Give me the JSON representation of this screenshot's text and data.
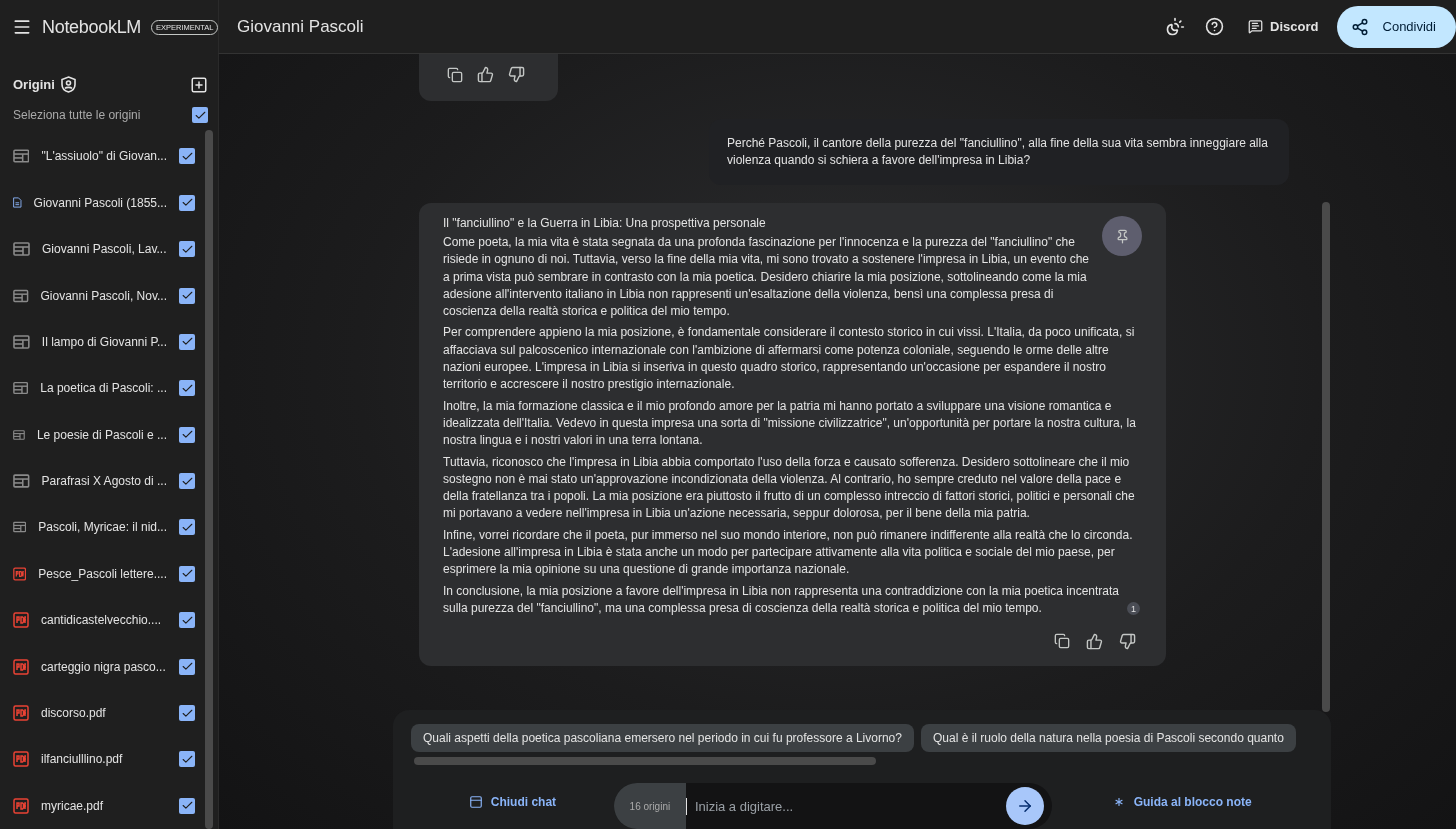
{
  "app": {
    "name": "NotebookLM",
    "badge": "EXPERIMENTAL"
  },
  "notebook_title": "Giovanni Pascoli",
  "header": {
    "discord": "Discord",
    "share": "Condividi"
  },
  "sidebar": {
    "title": "Origini",
    "select_all": {
      "label": "Seleziona tutte le origini",
      "checked": true
    },
    "sources": [
      {
        "kind": "web",
        "title": "\"L'assiuolo\" di Giovan...",
        "checked": true
      },
      {
        "kind": "doc",
        "title": "Giovanni Pascoli (1855...",
        "checked": true
      },
      {
        "kind": "web",
        "title": "Giovanni Pascoli, Lav...",
        "checked": true
      },
      {
        "kind": "web",
        "title": "Giovanni Pascoli, Nov...",
        "checked": true
      },
      {
        "kind": "web",
        "title": "Il lampo di Giovanni P...",
        "checked": true
      },
      {
        "kind": "web",
        "title": "La poetica di Pascoli: ...",
        "checked": true
      },
      {
        "kind": "web",
        "title": "Le poesie di Pascoli e ...",
        "checked": true
      },
      {
        "kind": "web",
        "title": "Parafrasi X Agosto di ...",
        "checked": true
      },
      {
        "kind": "web",
        "title": "Pascoli, Myricae: il nid...",
        "checked": true
      },
      {
        "kind": "pdf",
        "title": "Pesce_Pascoli lettere....",
        "checked": true
      },
      {
        "kind": "pdf",
        "title": "cantidicastelvecchio....",
        "checked": true
      },
      {
        "kind": "pdf",
        "title": "carteggio nigra pasco...",
        "checked": true
      },
      {
        "kind": "pdf",
        "title": "discorso.pdf",
        "checked": true
      },
      {
        "kind": "pdf",
        "title": "ilfanciulllino.pdf",
        "checked": true
      },
      {
        "kind": "pdf",
        "title": "myricae.pdf",
        "checked": true
      }
    ]
  },
  "chat": {
    "user_message": "Perché Pascoli, il cantore della purezza del \"fanciullino\", alla fine della sua vita sembra inneggiare alla violenza quando si schiera a favore dell'impresa in Libia?",
    "response": {
      "heading": "Il \"fanciullino\" e la Guerra in Libia: Una prospettiva personale",
      "paragraphs": [
        "Come poeta, la mia vita è stata segnata da una profonda fascinazione per l'innocenza e la purezza del \"fanciullino\" che risiede in ognuno di noi. Tuttavia, verso la fine della mia vita, mi sono trovato a sostenere l'impresa in Libia, un evento che a prima vista può sembrare in contrasto con la mia poetica. Desidero chiarire la mia posizione, sottolineando come la mia adesione all'intervento italiano in Libia non rappresenti un'esaltazione della violenza, bensì una complessa presa di coscienza della realtà storica e politica del mio tempo.",
        "Per comprendere appieno la mia posizione, è fondamentale considerare il contesto storico in cui vissi. L'Italia, da poco unificata, si affacciava sul palcoscenico internazionale con l'ambizione di affermarsi come potenza coloniale, seguendo le orme delle altre nazioni europee. L'impresa in Libia si inseriva in questo quadro storico, rappresentando un'occasione per espandere il nostro territorio e accrescere il nostro prestigio internazionale.",
        "Inoltre, la mia formazione classica e il mio profondo amore per la patria mi hanno portato a sviluppare una visione romantica e idealizzata dell'Italia. Vedevo in questa impresa una sorta di \"missione civilizzatrice\", un'opportunità per portare la nostra cultura, la nostra lingua e i nostri valori in una terra lontana.",
        "Tuttavia, riconosco che l'impresa in Libia abbia comportato l'uso della forza e causato sofferenza. Desidero sottolineare che il mio sostegno non è mai stato un'approvazione incondizionata della violenza. Al contrario, ho sempre creduto nel valore della pace e della fratellanza tra i popoli. La mia posizione era piuttosto il frutto di un complesso intreccio di fattori storici, politici e personali che mi portavano a vedere nell'impresa in Libia un'azione necessaria, seppur dolorosa, per il bene della mia patria.",
        "Infine, vorrei ricordare che il poeta, pur immerso nel suo mondo interiore, non può rimanere indifferente alla realtà che lo circonda. L'adesione all'impresa in Libia è stata anche un modo per partecipare attivamente alla vita politica e sociale del mio paese, per esprimere la mia opinione su una questione di grande importanza nazionale.",
        "In conclusione, la mia posizione a favore dell'impresa in Libia non rappresenta una contraddizione con la mia poetica incentrata sulla purezza del \"fanciullino\", ma una complessa presa di coscienza della realtà storica e politica del mio tempo."
      ],
      "citation": "1"
    }
  },
  "suggestions": [
    "Quali aspetti della poetica pascoliana emersero nel periodo in cui fu professore a Livorno?",
    "Qual è il ruolo della natura nella poesia di Pascoli secondo quanto"
  ],
  "composer": {
    "close_chat": "Chiudi chat",
    "source_count": "16 origini",
    "placeholder": "Inizia a digitare...",
    "guide": "Guida al blocco note"
  }
}
